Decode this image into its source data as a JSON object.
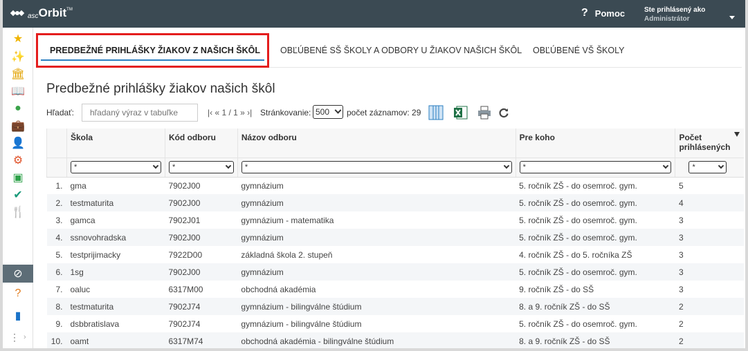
{
  "app": {
    "logo_asc": "asc",
    "logo_orbit": "Orbit",
    "logo_tm": "TM",
    "help_label": "Pomoc",
    "help_icon": "?",
    "user_line": "Ste prihlásený ako",
    "user_role": "Administrátor"
  },
  "sidebar": {
    "items": [
      {
        "icon": "star-icon",
        "glyph": "★",
        "color": "#f0b400"
      },
      {
        "icon": "magic-wand-icon",
        "glyph": "✨",
        "color": "#e0532a"
      },
      {
        "icon": "bank-icon",
        "glyph": "🏛",
        "color": "#e2a200"
      },
      {
        "icon": "book-open-icon",
        "glyph": "📖",
        "color": "#1a73c8"
      },
      {
        "icon": "map-pin-icon",
        "glyph": "●",
        "color": "#3aa34a"
      },
      {
        "icon": "briefcase-icon",
        "glyph": "💼",
        "color": "#1a73c8"
      },
      {
        "icon": "person-icon",
        "glyph": "👤",
        "color": "#e07a1a"
      },
      {
        "icon": "school-settings-icon",
        "glyph": "⚙",
        "color": "#e0532a"
      },
      {
        "icon": "badge-person-icon",
        "glyph": "▣",
        "color": "#2fa24a"
      },
      {
        "icon": "check-circle-icon",
        "glyph": "✔",
        "color": "#1a9a7a"
      },
      {
        "icon": "cutlery-icon",
        "glyph": "🍴",
        "color": "#8a3aa8"
      },
      {
        "icon": "compass-icon",
        "glyph": "⊘",
        "color": "#ffffff"
      },
      {
        "icon": "question-doc-icon",
        "glyph": "?",
        "color": "#e07a1a"
      },
      {
        "icon": "notebook-icon",
        "glyph": "▮",
        "color": "#1a73c8"
      }
    ],
    "more_glyph": "⋮",
    "arrow_glyph": "›"
  },
  "tabs": [
    {
      "label": "PREDBEŽNÉ PRIHLÁŠKY ŽIAKOV Z NAŠICH ŠKÔL",
      "active": true
    },
    {
      "label": "OBĽÚBENÉ SŠ ŠKOLY A ODBORY U ŽIAKOV NAŠICH ŠKÔL",
      "active": false
    },
    {
      "label": "OBĽÚBENÉ VŠ ŠKOLY",
      "active": false
    }
  ],
  "main": {
    "title": "Predbežné prihlášky žiakov našich škôl",
    "search_label": "Hľadať:",
    "search_placeholder": "hľadaný výraz v tabuľke",
    "pager_text": "|‹ « 1 / 1 » ›|",
    "paging_label": "Stránkovanie:",
    "paging_value": "500",
    "count_text": "počet záznamov: 29"
  },
  "table": {
    "headers": [
      "Škola",
      "Kód odboru",
      "Názov odboru",
      "Pre koho",
      "Počet prihlásených"
    ],
    "filter_value": "*",
    "rows": [
      {
        "n": "1.",
        "skola": "gma",
        "kod": "7902J00",
        "nazov": "gymnázium",
        "pre": "5. ročník ZŠ - do osemroč. gym.",
        "pocet": "5"
      },
      {
        "n": "2.",
        "skola": "testmaturita",
        "kod": "7902J00",
        "nazov": "gymnázium",
        "pre": "5. ročník ZŠ - do osemroč. gym.",
        "pocet": "4"
      },
      {
        "n": "3.",
        "skola": "gamca",
        "kod": "7902J01",
        "nazov": "gymnázium - matematika",
        "pre": "5. ročník ZŠ - do osemroč. gym.",
        "pocet": "3"
      },
      {
        "n": "4.",
        "skola": "ssnovohradska",
        "kod": "7902J00",
        "nazov": "gymnázium",
        "pre": "5. ročník ZŠ - do osemroč. gym.",
        "pocet": "3"
      },
      {
        "n": "5.",
        "skola": "testprijimacky",
        "kod": "7922D00",
        "nazov": "základná škola 2. stupeň",
        "pre": "4. ročník ZŠ - do 5. ročníka ZŠ",
        "pocet": "3"
      },
      {
        "n": "6.",
        "skola": "1sg",
        "kod": "7902J00",
        "nazov": "gymnázium",
        "pre": "5. ročník ZŠ - do osemroč. gym.",
        "pocet": "3"
      },
      {
        "n": "7.",
        "skola": "oaluc",
        "kod": "6317M00",
        "nazov": "obchodná akadémia",
        "pre": "9. ročník ZŠ - do SŠ",
        "pocet": "3"
      },
      {
        "n": "8.",
        "skola": "testmaturita",
        "kod": "7902J74",
        "nazov": "gymnázium - bilingválne štúdium",
        "pre": "8. a 9. ročník ZŠ - do SŠ",
        "pocet": "2"
      },
      {
        "n": "9.",
        "skola": "dsbbratislava",
        "kod": "7902J74",
        "nazov": "gymnázium - bilingválne štúdium",
        "pre": "5. ročník ZŠ - do osemroč. gym.",
        "pocet": "2"
      },
      {
        "n": "10.",
        "skola": "oamt",
        "kod": "6317M74",
        "nazov": "obchodná akadémia - bilingválne štúdium",
        "pre": "8. a 9. ročník ZŠ - do SŠ",
        "pocet": "2"
      }
    ]
  }
}
